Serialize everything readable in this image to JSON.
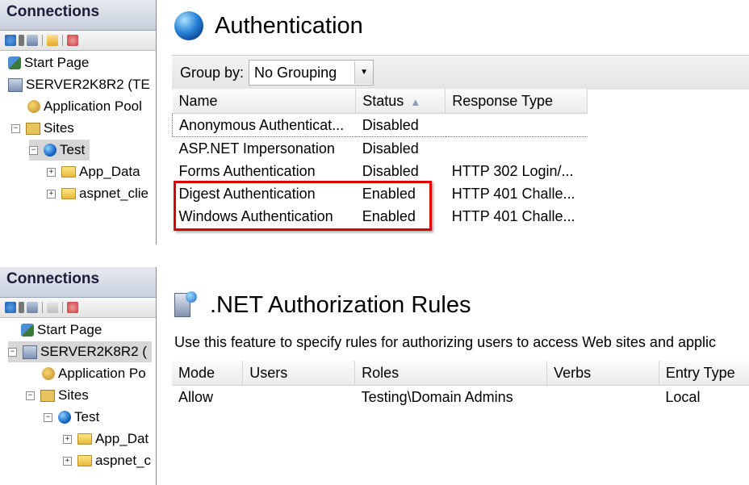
{
  "top": {
    "connections": {
      "title": "Connections",
      "tree": [
        {
          "label": "Start Page",
          "icon": "start-page-icon"
        },
        {
          "label": "SERVER2K8R2 (TE",
          "icon": "server-icon"
        },
        {
          "label": "Application Pool",
          "icon": "app-pools-icon"
        },
        {
          "label": "Sites",
          "icon": "sites-icon"
        },
        {
          "label": "Test",
          "icon": "globe-icon"
        },
        {
          "label": "App_Data",
          "icon": "folder-icon"
        },
        {
          "label": "aspnet_clie",
          "icon": "folder-icon"
        }
      ]
    },
    "feature": {
      "title": "Authentication",
      "group_by_label": "Group by:",
      "group_by_value": "No Grouping",
      "columns": [
        "Name",
        "Status",
        "Response Type"
      ],
      "rows": [
        {
          "name": "Anonymous Authenticat...",
          "status": "Disabled",
          "response": ""
        },
        {
          "name": "ASP.NET Impersonation",
          "status": "Disabled",
          "response": ""
        },
        {
          "name": "Forms Authentication",
          "status": "Disabled",
          "response": "HTTP 302 Login/..."
        },
        {
          "name": "Digest Authentication",
          "status": "Enabled",
          "response": "HTTP 401 Challe..."
        },
        {
          "name": "Windows Authentication",
          "status": "Enabled",
          "response": "HTTP 401 Challe..."
        }
      ]
    }
  },
  "bottom": {
    "connections": {
      "title": "Connections",
      "tree": [
        {
          "label": "Start Page",
          "icon": "start-page-icon"
        },
        {
          "label": "SERVER2K8R2 (",
          "icon": "server-icon"
        },
        {
          "label": "Application Po",
          "icon": "app-pools-icon"
        },
        {
          "label": "Sites",
          "icon": "sites-icon"
        },
        {
          "label": "Test",
          "icon": "globe-icon"
        },
        {
          "label": "App_Dat",
          "icon": "folder-icon"
        },
        {
          "label": "aspnet_c",
          "icon": "folder-icon"
        }
      ]
    },
    "feature": {
      "title": ".NET Authorization Rules",
      "description": "Use this feature to specify rules for authorizing users to access Web sites and applic",
      "columns": [
        "Mode",
        "Users",
        "Roles",
        "Verbs",
        "Entry Type"
      ],
      "rows": [
        {
          "mode": "Allow",
          "users": "",
          "roles": "Testing\\Domain Admins",
          "verbs": "",
          "entry_type": "Local"
        }
      ]
    }
  },
  "colors": {
    "highlight": "#e10000",
    "selection": "#d7d7d7"
  }
}
